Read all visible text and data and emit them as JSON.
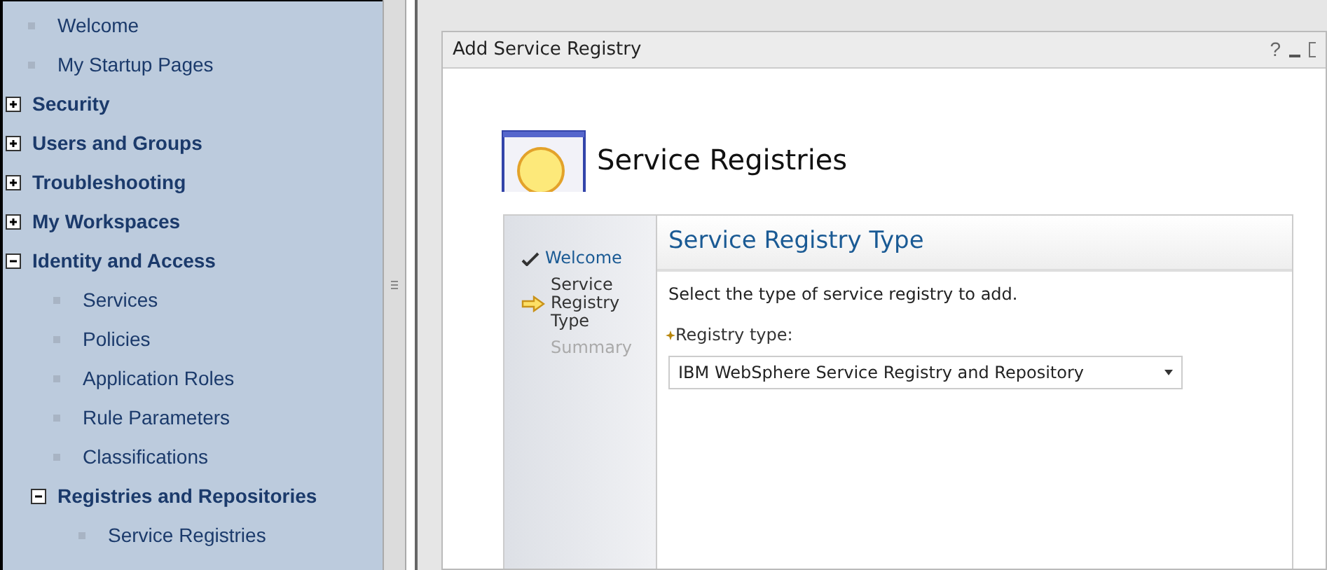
{
  "navigation": {
    "items": [
      {
        "label": "Welcome",
        "kind": "leaf"
      },
      {
        "label": "My Startup Pages",
        "kind": "leaf"
      },
      {
        "label": "Security",
        "kind": "group",
        "expanded": false
      },
      {
        "label": "Users and Groups",
        "kind": "group",
        "expanded": false
      },
      {
        "label": "Troubleshooting",
        "kind": "group",
        "expanded": false
      },
      {
        "label": "My Workspaces",
        "kind": "group",
        "expanded": false
      },
      {
        "label": "Identity and Access",
        "kind": "group",
        "expanded": true,
        "children": [
          {
            "label": "Services",
            "kind": "leaf"
          },
          {
            "label": "Policies",
            "kind": "leaf"
          },
          {
            "label": "Application Roles",
            "kind": "leaf"
          },
          {
            "label": "Rule Parameters",
            "kind": "leaf"
          },
          {
            "label": "Classifications",
            "kind": "leaf"
          },
          {
            "label": "Registries and Repositories",
            "kind": "group",
            "expanded": true,
            "children": [
              {
                "label": "Service Registries",
                "kind": "leaf"
              }
            ]
          }
        ]
      }
    ]
  },
  "dialog": {
    "title": "Add Service Registry",
    "controls": [
      "?"
    ],
    "heading": "Service Registries",
    "wizard": {
      "steps": [
        {
          "label": "Welcome",
          "completed": true,
          "selected": false
        },
        {
          "label": "Service Registry Type",
          "completed": false,
          "selected": true
        },
        {
          "label": "Summary",
          "completed": false,
          "selected": false
        }
      ],
      "page_title": "Service Registry Type",
      "instruction": "Select the type of service registry to add.",
      "field": {
        "label": "Registry type:",
        "required": true,
        "value": "IBM WebSphere Service Registry and Repository"
      }
    }
  }
}
